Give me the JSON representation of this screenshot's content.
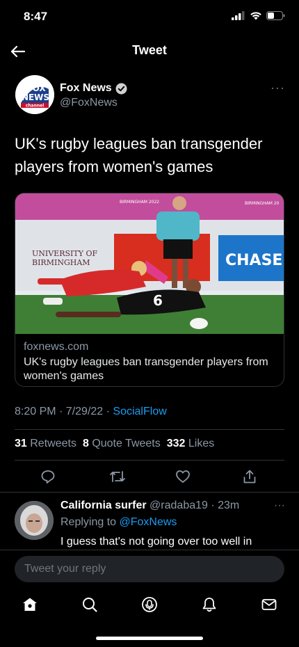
{
  "status_bar": {
    "time": "8:47"
  },
  "header": {
    "title": "Tweet"
  },
  "author": {
    "name": "Fox News",
    "handle": "@FoxNews",
    "avatar_logo_lines": [
      "FOX",
      "NEWS",
      "channel"
    ],
    "verified": true
  },
  "tweet": {
    "text": "UK's rugby leagues ban transgender players from women's games",
    "time": "8:20 PM · 7/29/22 · ",
    "source": "SocialFlow"
  },
  "card": {
    "domain": "foxnews.com",
    "title": "UK's rugby leagues ban transgender players from women's games",
    "image_signs": [
      "UNIVERSITY OF",
      "BIRMINGHAM",
      "CHASE",
      "BIRMINGHAM 2022",
      "BIRMINGHAM 20"
    ]
  },
  "stats": {
    "retweets_count": "31",
    "retweets_label": "Retweets",
    "quotes_count": "8",
    "quotes_label": "Quote Tweets",
    "likes_count": "332",
    "likes_label": "Likes"
  },
  "reply": {
    "name": "California surfer",
    "handle_time": "@radaba19 · 23m",
    "replying_prefix": "Replying to ",
    "replying_to": "@FoxNews",
    "text": "I guess that's not going over too well in"
  },
  "compose": {
    "placeholder": "Tweet your reply"
  },
  "colors": {
    "accent": "#1d9bf0",
    "background": "#000000",
    "muted": "#8b98a5",
    "border": "#2f3336"
  },
  "icons": [
    "back-arrow-icon",
    "verified-badge-icon",
    "more-icon",
    "reply-icon",
    "retweet-icon",
    "like-icon",
    "share-icon",
    "home-icon",
    "search-icon",
    "spaces-icon",
    "notifications-icon",
    "messages-icon"
  ]
}
